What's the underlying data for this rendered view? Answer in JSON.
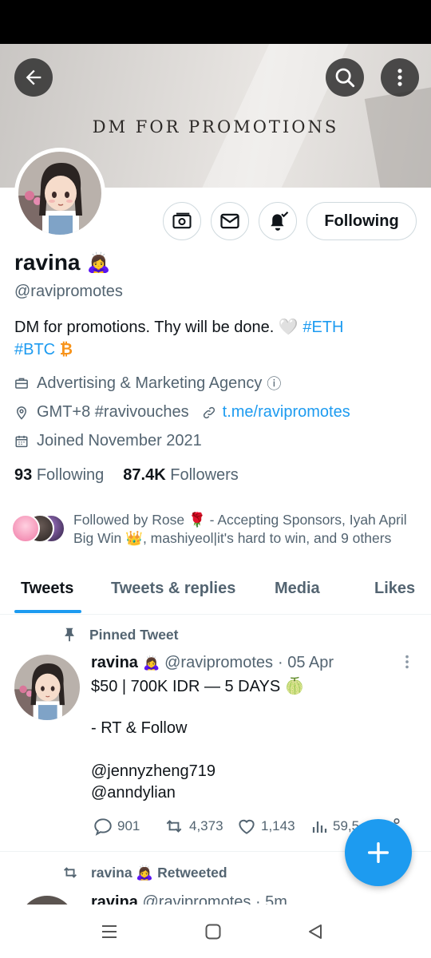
{
  "banner": {
    "text": "DM FOR PROMOTIONS"
  },
  "profile": {
    "name": "ravina",
    "name_emoji": "🙇‍♀️",
    "handle": "@ravipromotes",
    "bio_text": "DM for promotions. Thy will be done. 🤍 ",
    "bio_tag1": "#ETH",
    "bio_tag2": "#BTC",
    "bio_btc_symbol": "₿",
    "category": "Advertising & Marketing Agency",
    "category_info_symbol": "ⓘ",
    "location": "GMT+8 #ravivouches",
    "website": "t.me/ravipromotes",
    "joined": "Joined November 2021",
    "following_count": "93",
    "following_label": "Following",
    "followers_count": "87.4K",
    "followers_label": "Followers",
    "followed_by": "Followed by Rose 🌹 - Accepting Sponsors, Iyah April Big Win 👑, mashiyeol|it's hard to win, and 9 others"
  },
  "buttons": {
    "following": "Following"
  },
  "tabs": [
    "Tweets",
    "Tweets & replies",
    "Media",
    "Likes"
  ],
  "pinned_tweet": {
    "pinned_label": "Pinned Tweet",
    "author": "ravina",
    "author_emoji": "🙇‍♀️",
    "handle": "@ravipromotes",
    "time": "· 05 Apr",
    "line1": "$50 | 700K IDR — 5 DAYS 🍈",
    "line2": "- RT & Follow",
    "mention1": "@jennyzheng719",
    "mention2": "@anndylian",
    "replies": "901",
    "retweets": "4,373",
    "likes": "1,143",
    "views": "59,5"
  },
  "retweet": {
    "label": "ravina 🙇‍♀️ Retweeted",
    "author": "ravina",
    "handle": "@ravipromotes",
    "time": "· 5m"
  },
  "colors": {
    "accent": "#1d9bf0",
    "secondary_text": "#536471",
    "btc": "#f7931a"
  },
  "icons": [
    "back-arrow-icon",
    "search-icon",
    "more-vertical-icon",
    "money-icon",
    "mail-icon",
    "bell-icon",
    "briefcase-icon",
    "location-icon",
    "link-icon",
    "calendar-icon",
    "pin-icon",
    "reply-icon",
    "retweet-icon",
    "like-icon",
    "views-icon",
    "share-icon",
    "compose-icon",
    "nav-menu-icon",
    "nav-home-icon",
    "nav-back-icon"
  ]
}
